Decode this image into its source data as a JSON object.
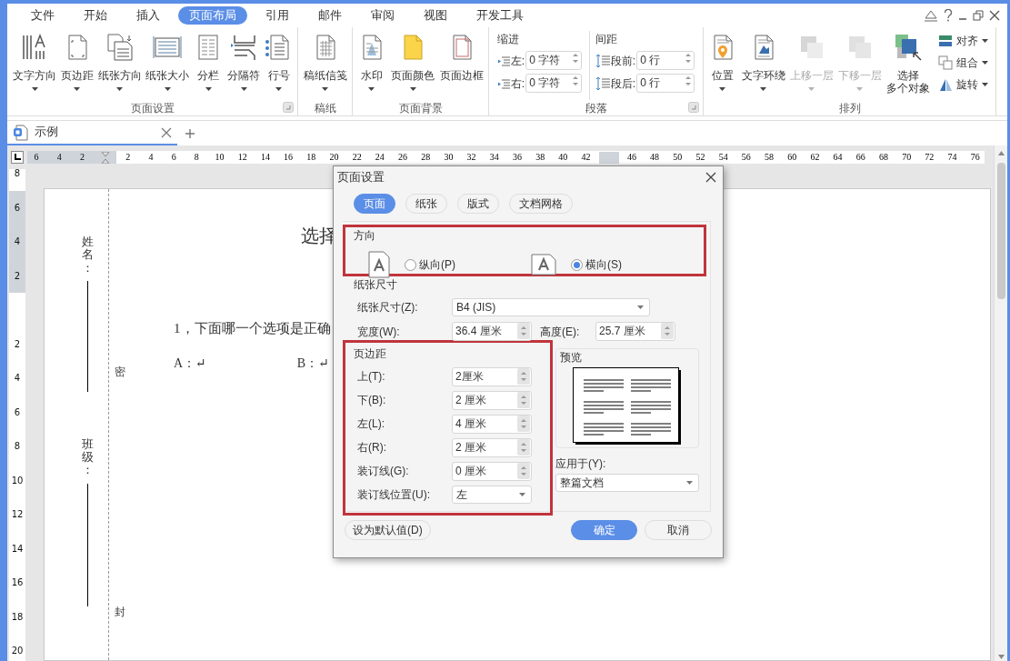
{
  "menu_tabs": [
    {
      "label": "文件",
      "selected": false
    },
    {
      "label": "开始",
      "selected": false
    },
    {
      "label": "插入",
      "selected": false
    },
    {
      "label": "页面布局",
      "selected": true
    },
    {
      "label": "引用",
      "selected": false
    },
    {
      "label": "邮件",
      "selected": false
    },
    {
      "label": "审阅",
      "selected": false
    },
    {
      "label": "视图",
      "selected": false
    },
    {
      "label": "开发工具",
      "selected": false
    }
  ],
  "ribbon": [
    {
      "title": "页面设置",
      "launcher": true,
      "items": [
        {
          "kind": "large",
          "label": "文字方向",
          "dropdown": true,
          "disabled": false
        },
        {
          "kind": "large",
          "label": "页边距",
          "dropdown": true,
          "disabled": false
        },
        {
          "kind": "large",
          "label": "纸张方向",
          "dropdown": true,
          "disabled": false
        },
        {
          "kind": "large",
          "label": "纸张大小",
          "dropdown": true,
          "disabled": false
        },
        {
          "kind": "large",
          "label": "分栏",
          "dropdown": true,
          "disabled": false
        },
        {
          "kind": "large",
          "label": "分隔符",
          "dropdown": true,
          "disabled": false
        },
        {
          "kind": "large",
          "label": "行号",
          "dropdown": true,
          "disabled": false
        }
      ]
    },
    {
      "title": "稿纸",
      "launcher": false,
      "items": [
        {
          "kind": "large",
          "label": "稿纸信笺",
          "dropdown": true,
          "disabled": false
        }
      ]
    },
    {
      "title": "页面背景",
      "launcher": false,
      "items": [
        {
          "kind": "large",
          "label": "水印",
          "dropdown": true,
          "disabled": false
        },
        {
          "kind": "large",
          "label": "页面颜色",
          "dropdown": true,
          "disabled": false
        },
        {
          "kind": "large",
          "label": "页面边框",
          "dropdown": false,
          "disabled": false
        }
      ]
    },
    {
      "title": "段落",
      "launcher": true,
      "items": [
        {
          "kind": "fields",
          "heading": "缩进",
          "rows": [
            {
              "label": "左:",
              "value": "0 字符"
            },
            {
              "label": "右:",
              "value": "0 字符"
            }
          ]
        },
        {
          "kind": "fields",
          "heading": "间距",
          "rows": [
            {
              "label": "段前:",
              "value": "0 行"
            },
            {
              "label": "段后:",
              "value": "0 行"
            }
          ]
        }
      ]
    },
    {
      "title": "排列",
      "launcher": false,
      "items": [
        {
          "kind": "large",
          "label": "位置",
          "dropdown": true,
          "disabled": false
        },
        {
          "kind": "large",
          "label": "文字环绕",
          "dropdown": true,
          "disabled": false
        },
        {
          "kind": "large",
          "label": "上移一层",
          "dropdown": true,
          "disabled": true
        },
        {
          "kind": "large",
          "label": "下移一层",
          "dropdown": true,
          "disabled": true
        },
        {
          "kind": "large",
          "lines": [
            "选择",
            "多个对象"
          ],
          "dropdown": false,
          "disabled": false
        },
        {
          "kind": "small_stack",
          "rows": [
            {
              "label": "对齐",
              "dropdown": true
            },
            {
              "label": "组合",
              "dropdown": true
            },
            {
              "label": "旋转",
              "dropdown": true
            }
          ]
        }
      ]
    }
  ],
  "doc_tabs": [
    {
      "label": "示例",
      "selected": true
    }
  ],
  "ruler": {
    "left_labels": [
      "6",
      "4",
      "2"
    ],
    "right_labels": [
      "2",
      "4",
      "6",
      "8",
      "10",
      "12",
      "14",
      "16",
      "18",
      "20",
      "22",
      "24",
      "26",
      "28",
      "30",
      "32",
      "34",
      "36",
      "38",
      "40",
      "42"
    ],
    "far_labels": [
      "46",
      "48",
      "50",
      "52",
      "54",
      "56",
      "58",
      "60",
      "62",
      "64",
      "66",
      "68",
      "70",
      "72",
      "74",
      "76"
    ],
    "upper_labels": [
      "8",
      "6",
      "4",
      "2"
    ],
    "lower_labels": [
      "2",
      "4",
      "6",
      "8",
      "10",
      "12",
      "14",
      "16",
      "18",
      "20"
    ]
  },
  "document": {
    "name_label": "姓名：",
    "class_label": "班级：",
    "marks": [
      "密",
      "封"
    ],
    "title": "选择",
    "question": "1，下面哪一个选项是正确",
    "options": [
      "A：↵",
      "B：↵"
    ]
  },
  "dialog": {
    "title": "页面设置",
    "tabs": [
      {
        "label": "页面",
        "selected": true
      },
      {
        "label": "纸张",
        "selected": false
      },
      {
        "label": "版式",
        "selected": false
      },
      {
        "label": "文档网格",
        "selected": false
      }
    ],
    "orientation": {
      "title": "方向",
      "highlighted": true,
      "options": [
        {
          "label": "纵向(P)",
          "selected": false
        },
        {
          "label": "横向(S)",
          "selected": true
        }
      ]
    },
    "paper": {
      "title": "纸张尺寸",
      "size_label": "纸张尺寸(Z):",
      "size_value": "B4 (JIS)",
      "width_label": "宽度(W):",
      "width_value": "36.4 厘米",
      "height_label": "高度(E):",
      "height_value": "25.7 厘米"
    },
    "margins": {
      "title": "页边距",
      "highlighted": true,
      "fields": [
        {
          "label": "上(T):",
          "value": "2厘米",
          "kind": "spin"
        },
        {
          "label": "下(B):",
          "value": "2 厘米",
          "kind": "spin"
        },
        {
          "label": "左(L):",
          "value": "4 厘米",
          "kind": "spin"
        },
        {
          "label": "右(R):",
          "value": "2 厘米",
          "kind": "spin"
        },
        {
          "label": "装订线(G):",
          "value": "0 厘米",
          "kind": "spin"
        },
        {
          "label": "装订线位置(U):",
          "value": "左",
          "kind": "select"
        }
      ]
    },
    "preview": {
      "title": "预览"
    },
    "apply": {
      "label": "应用于(Y):",
      "value": "整篇文档"
    },
    "buttons": [
      {
        "label": "设为默认值(D)",
        "kind": "default"
      },
      {
        "label": "确定",
        "kind": "primary"
      },
      {
        "label": "取消",
        "kind": "secondary"
      }
    ]
  }
}
